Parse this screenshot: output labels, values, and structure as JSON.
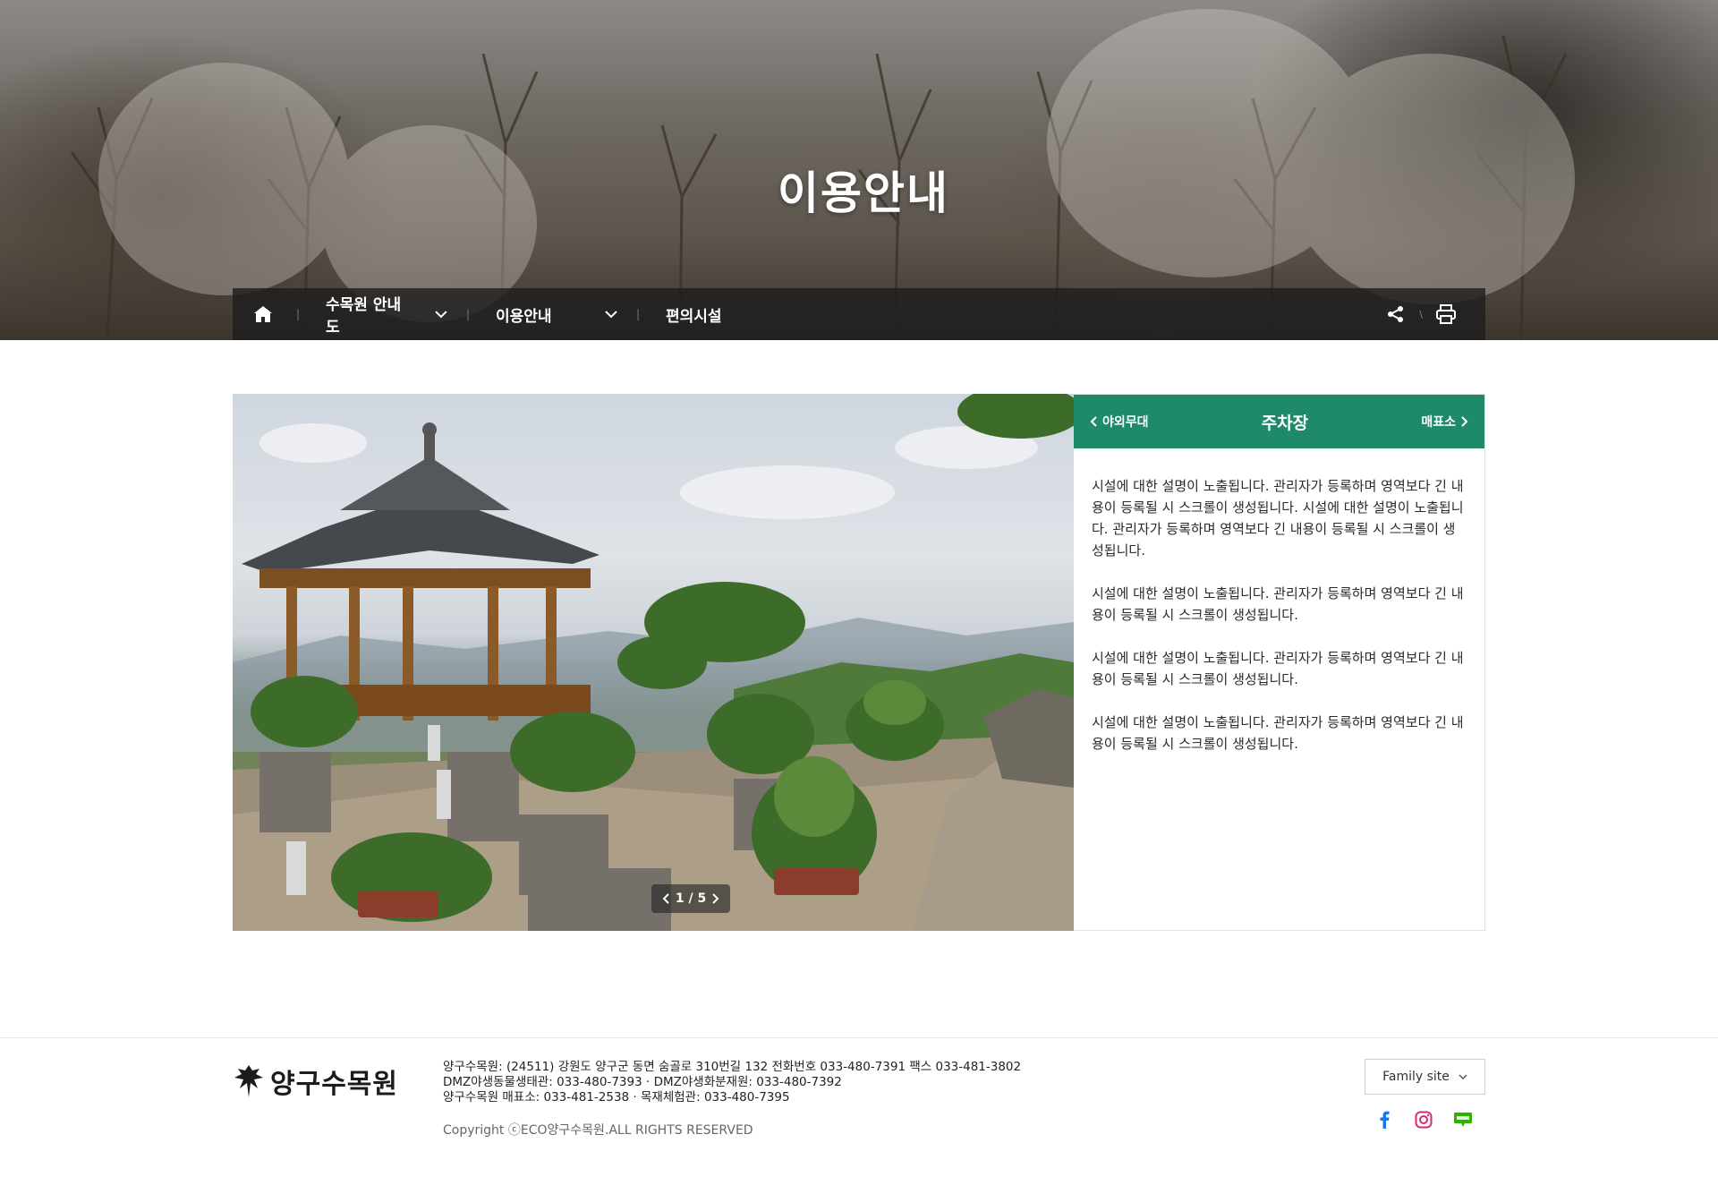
{
  "hero": {
    "title": "이용안내"
  },
  "location": {
    "home_icon": "home-icon",
    "items": [
      {
        "label": "수목원 안내도"
      },
      {
        "label": "이용안내"
      },
      {
        "label": "편의시설"
      }
    ],
    "share_icon": "share-icon",
    "print_icon": "print-icon"
  },
  "gallery": {
    "current": "1",
    "total": "5",
    "separator": "/"
  },
  "facility": {
    "prev_label": "야외무대",
    "title": "주차장",
    "next_label": "매표소",
    "header_color": "#1e8a6a",
    "paragraphs": [
      "시설에 대한 설명이 노출됩니다. 관리자가 등록하며 영역보다 긴 내용이 등록될 시 스크롤이 생성됩니다. 시설에 대한 설명이 노출됩니다. 관리자가 등록하며 영역보다 긴 내용이 등록될 시 스크롤이 생성됩니다.",
      "시설에 대한 설명이 노출됩니다. 관리자가 등록하며 영역보다 긴 내용이 등록될 시 스크롤이 생성됩니다.",
      "시설에 대한 설명이 노출됩니다. 관리자가 등록하며 영역보다 긴 내용이 등록될 시 스크롤이 생성됩니다.",
      "시설에 대한 설명이 노출됩니다. 관리자가 등록하며 영역보다 긴 내용이 등록될 시 스크롤이 생성됩니다."
    ]
  },
  "footer": {
    "logo_text": "양구수목원",
    "info_lines": [
      "양구수목원: (24511) 강원도 양구군 동면 숨골로 310번길 132 전화번호 033-480-7391 팩스 033-481-3802",
      "DMZ야생동물생태관: 033-480-7393 · DMZ야생화분재원: 033-480-7392",
      "양구수목원 매표소: 033-481-2538 · 목재체험관: 033-480-7395"
    ],
    "copyright": "Copyright ⓒECO양구수목원.ALL RIGHTS RESERVED",
    "family_site": "Family site",
    "sns": [
      "facebook-icon",
      "instagram-icon",
      "blog-icon"
    ]
  }
}
